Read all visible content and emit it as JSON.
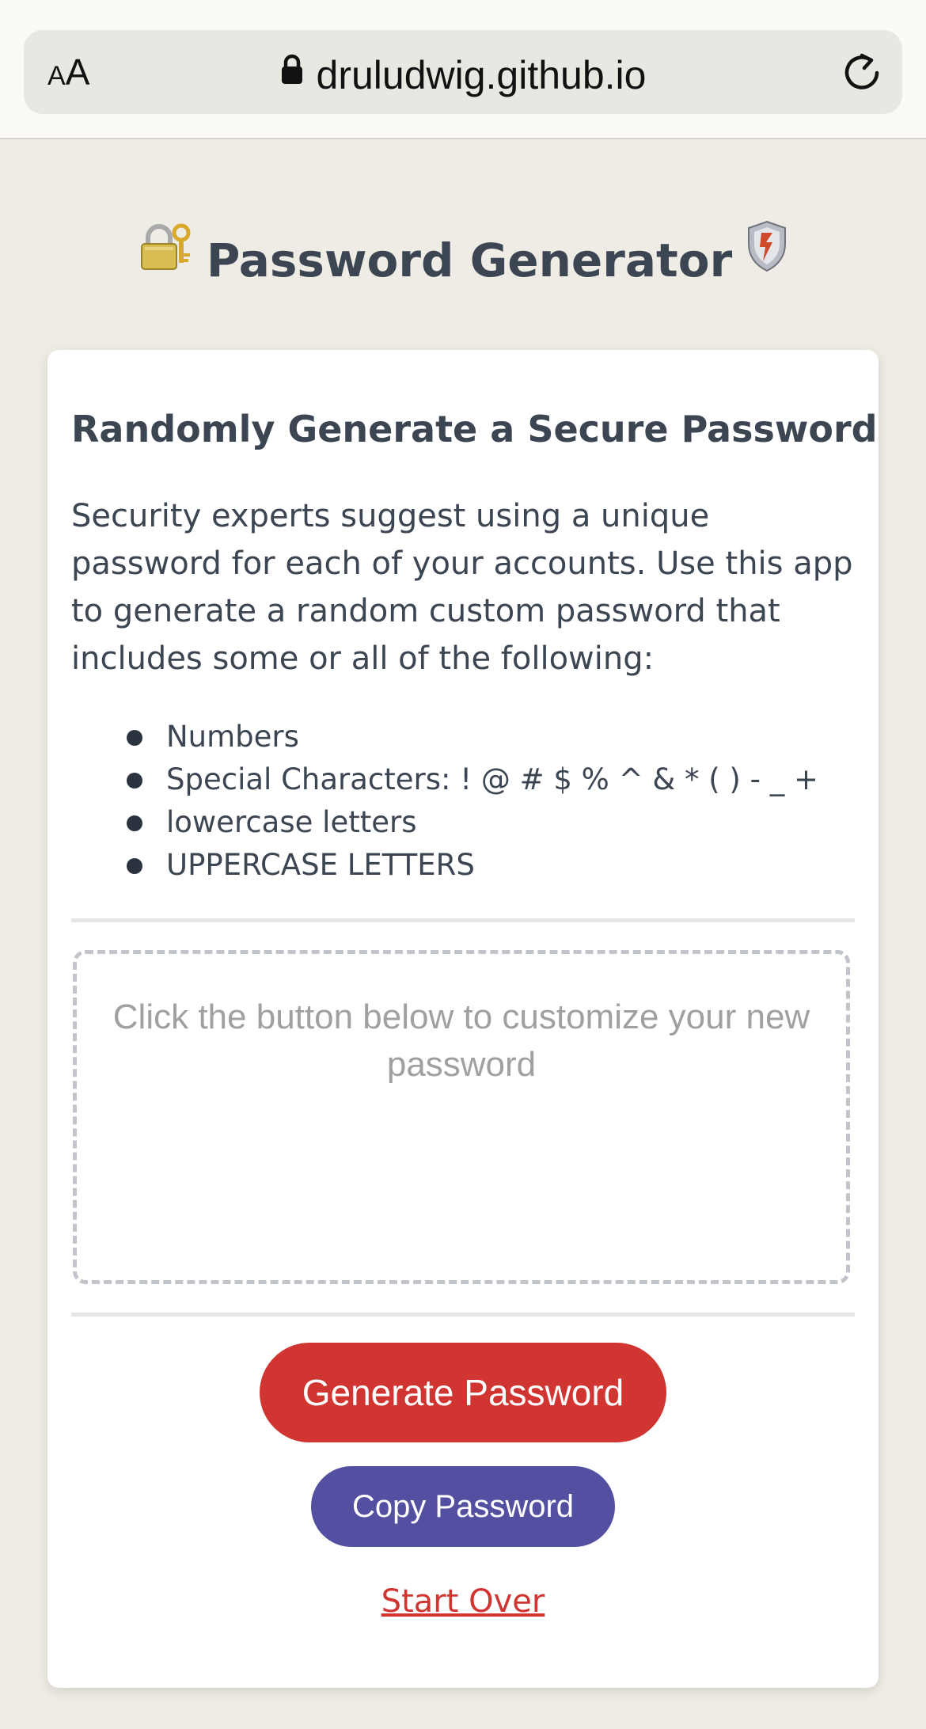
{
  "browser": {
    "text_size_label_small": "A",
    "text_size_label_big": "A",
    "url": "druludwig.github.io"
  },
  "page": {
    "heading": "Password Generator",
    "heading_left_icon": "locked-with-key-icon",
    "heading_right_icon": "shield-icon"
  },
  "card": {
    "title": "Randomly Generate a Secure Password",
    "description": "Security experts suggest using a unique password for each of your accounts. Use this app to generate a random custom password that includes some or all of the following:",
    "features": [
      "Numbers",
      "Special Characters: ! @ # $ % ^ & * ( ) - _ +",
      "lowercase letters",
      "UPPERCASE LETTERS"
    ],
    "password_placeholder": "Click the button below to customize your new password",
    "generate_label": "Generate Password",
    "copy_label": "Copy Password",
    "start_over_label": "Start Over"
  },
  "colors": {
    "page_background": "#efebe5",
    "text": "#3c4552",
    "generate_button": "#d13531",
    "copy_button": "#5450a1",
    "start_over_link": "#d13531",
    "placeholder_text": "#a0a0a0"
  }
}
